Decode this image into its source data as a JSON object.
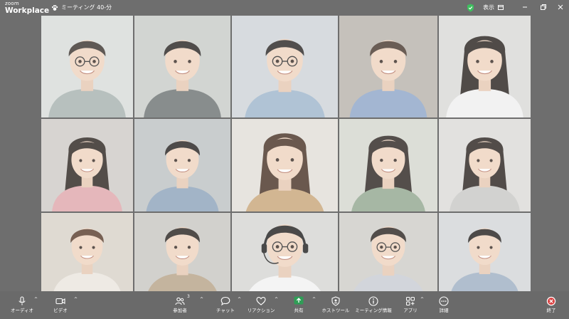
{
  "window": {
    "brand_small": "zoom",
    "brand_large": "Workplace",
    "meeting_title": "ミーティング 40-分",
    "view_label": "表示"
  },
  "colors": {
    "background": "#6e6e6e",
    "share_accent": "#2f9e56",
    "end_accent": "#d94040",
    "shield": "#3fbf5f"
  },
  "participants": [
    {
      "row": 1,
      "col": 1,
      "description": "woman-glasses"
    },
    {
      "row": 1,
      "col": 2,
      "description": "man-grey-shirt"
    },
    {
      "row": 1,
      "col": 3,
      "description": "man-glasses-blue-shirt"
    },
    {
      "row": 1,
      "col": 4,
      "description": "woman-blue-shirt"
    },
    {
      "row": 1,
      "col": 5,
      "description": "woman-long-hair"
    },
    {
      "row": 2,
      "col": 1,
      "description": "woman-pink-top"
    },
    {
      "row": 2,
      "col": 2,
      "description": "man-blue-shirt"
    },
    {
      "row": 2,
      "col": 3,
      "description": "woman-beige-top"
    },
    {
      "row": 2,
      "col": 4,
      "description": "woman-green-top"
    },
    {
      "row": 2,
      "col": 5,
      "description": "woman-grey-cardigan"
    },
    {
      "row": 3,
      "col": 1,
      "description": "woman-short-hair"
    },
    {
      "row": 3,
      "col": 2,
      "description": "man-beige-shirt"
    },
    {
      "row": 3,
      "col": 3,
      "description": "man-headset"
    },
    {
      "row": 3,
      "col": 4,
      "description": "woman-glasses-short-hair"
    },
    {
      "row": 3,
      "col": 5,
      "description": "man-blue-shirt-2"
    }
  ],
  "toolbar": {
    "audio": "オーディオ",
    "video": "ビデオ",
    "participants": "参加者",
    "participants_count": "3",
    "chat": "チャット",
    "reactions": "リアクション",
    "share": "共有",
    "host_tools": "ホストツール",
    "meeting_info": "ミーティング情報",
    "apps": "アプリ",
    "more": "詳細",
    "end": "終了"
  }
}
